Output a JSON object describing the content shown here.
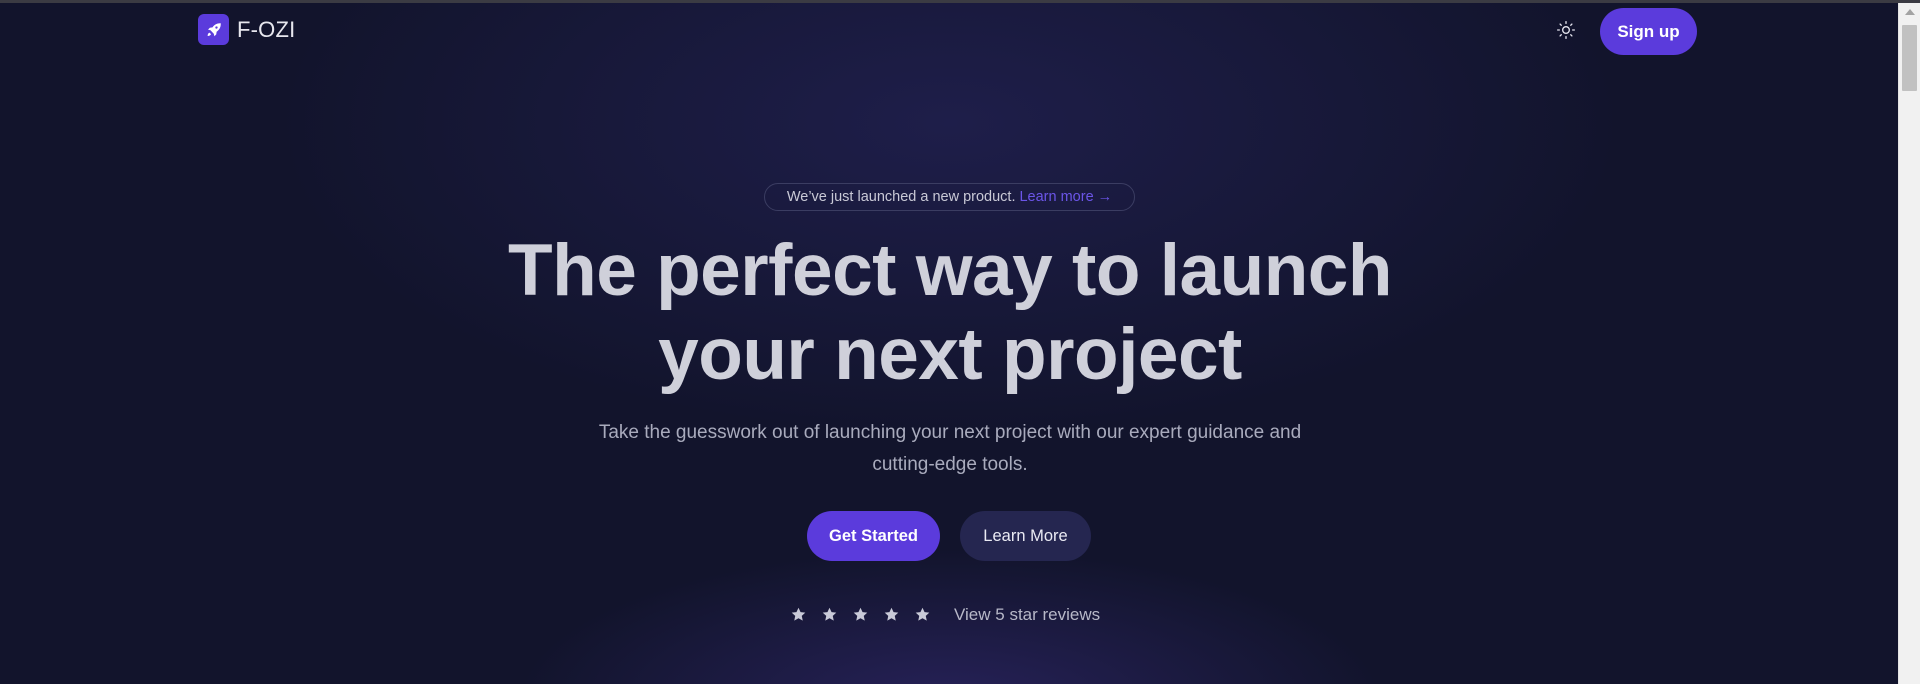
{
  "header": {
    "brand": "F-OZI",
    "signup_label": "Sign up"
  },
  "hero": {
    "badge_text": "We’ve just launched a new product.",
    "badge_link": "Learn more →",
    "headline_line1": "The perfect way to launch",
    "headline_line2": "your next project",
    "subtext_line1": "Take the guesswork out of launching your next project with our expert guidance and",
    "subtext_line2": "cutting-edge tools.",
    "primary_cta": "Get Started",
    "secondary_cta": "Learn More",
    "rating_stars": 5,
    "reviews_link": "View 5 star reviews"
  },
  "icons": {
    "logo": "rocket-icon",
    "theme_toggle": "sun-icon",
    "rating": "star-icon"
  },
  "colors": {
    "accent": "#5b3bdc",
    "background": "#12142c",
    "secondary_button": "#252650",
    "link": "#6b55e8"
  }
}
